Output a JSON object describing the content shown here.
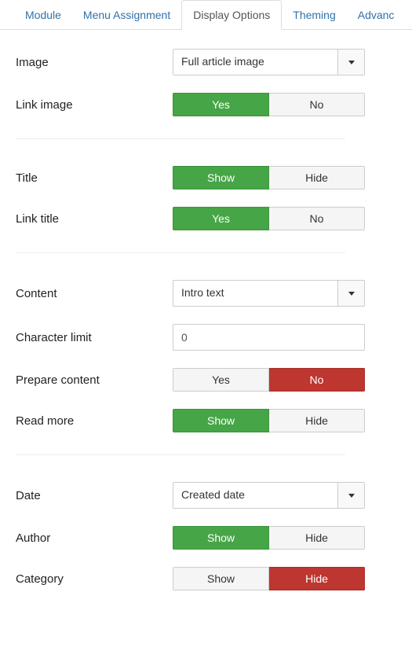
{
  "tabs": {
    "module": "Module",
    "menu_assignment": "Menu Assignment",
    "display_options": "Display Options",
    "theming": "Theming",
    "advanced": "Advanc"
  },
  "fields": {
    "image": {
      "label": "Image",
      "value": "Full article image"
    },
    "link_image": {
      "label": "Link image",
      "yes": "Yes",
      "no": "No",
      "selected": "yes"
    },
    "title": {
      "label": "Title",
      "show": "Show",
      "hide": "Hide",
      "selected": "show"
    },
    "link_title": {
      "label": "Link title",
      "yes": "Yes",
      "no": "No",
      "selected": "yes"
    },
    "content": {
      "label": "Content",
      "value": "Intro text"
    },
    "char_limit": {
      "label": "Character limit",
      "value": "0"
    },
    "prepare_content": {
      "label": "Prepare content",
      "yes": "Yes",
      "no": "No",
      "selected": "no"
    },
    "read_more": {
      "label": "Read more",
      "show": "Show",
      "hide": "Hide",
      "selected": "show"
    },
    "date": {
      "label": "Date",
      "value": "Created date"
    },
    "author": {
      "label": "Author",
      "show": "Show",
      "hide": "Hide",
      "selected": "show"
    },
    "category": {
      "label": "Category",
      "show": "Show",
      "hide": "Hide",
      "selected": "hide"
    }
  },
  "colors": {
    "green": "#46a546",
    "red": "#bd362f",
    "link": "#3071a9"
  }
}
